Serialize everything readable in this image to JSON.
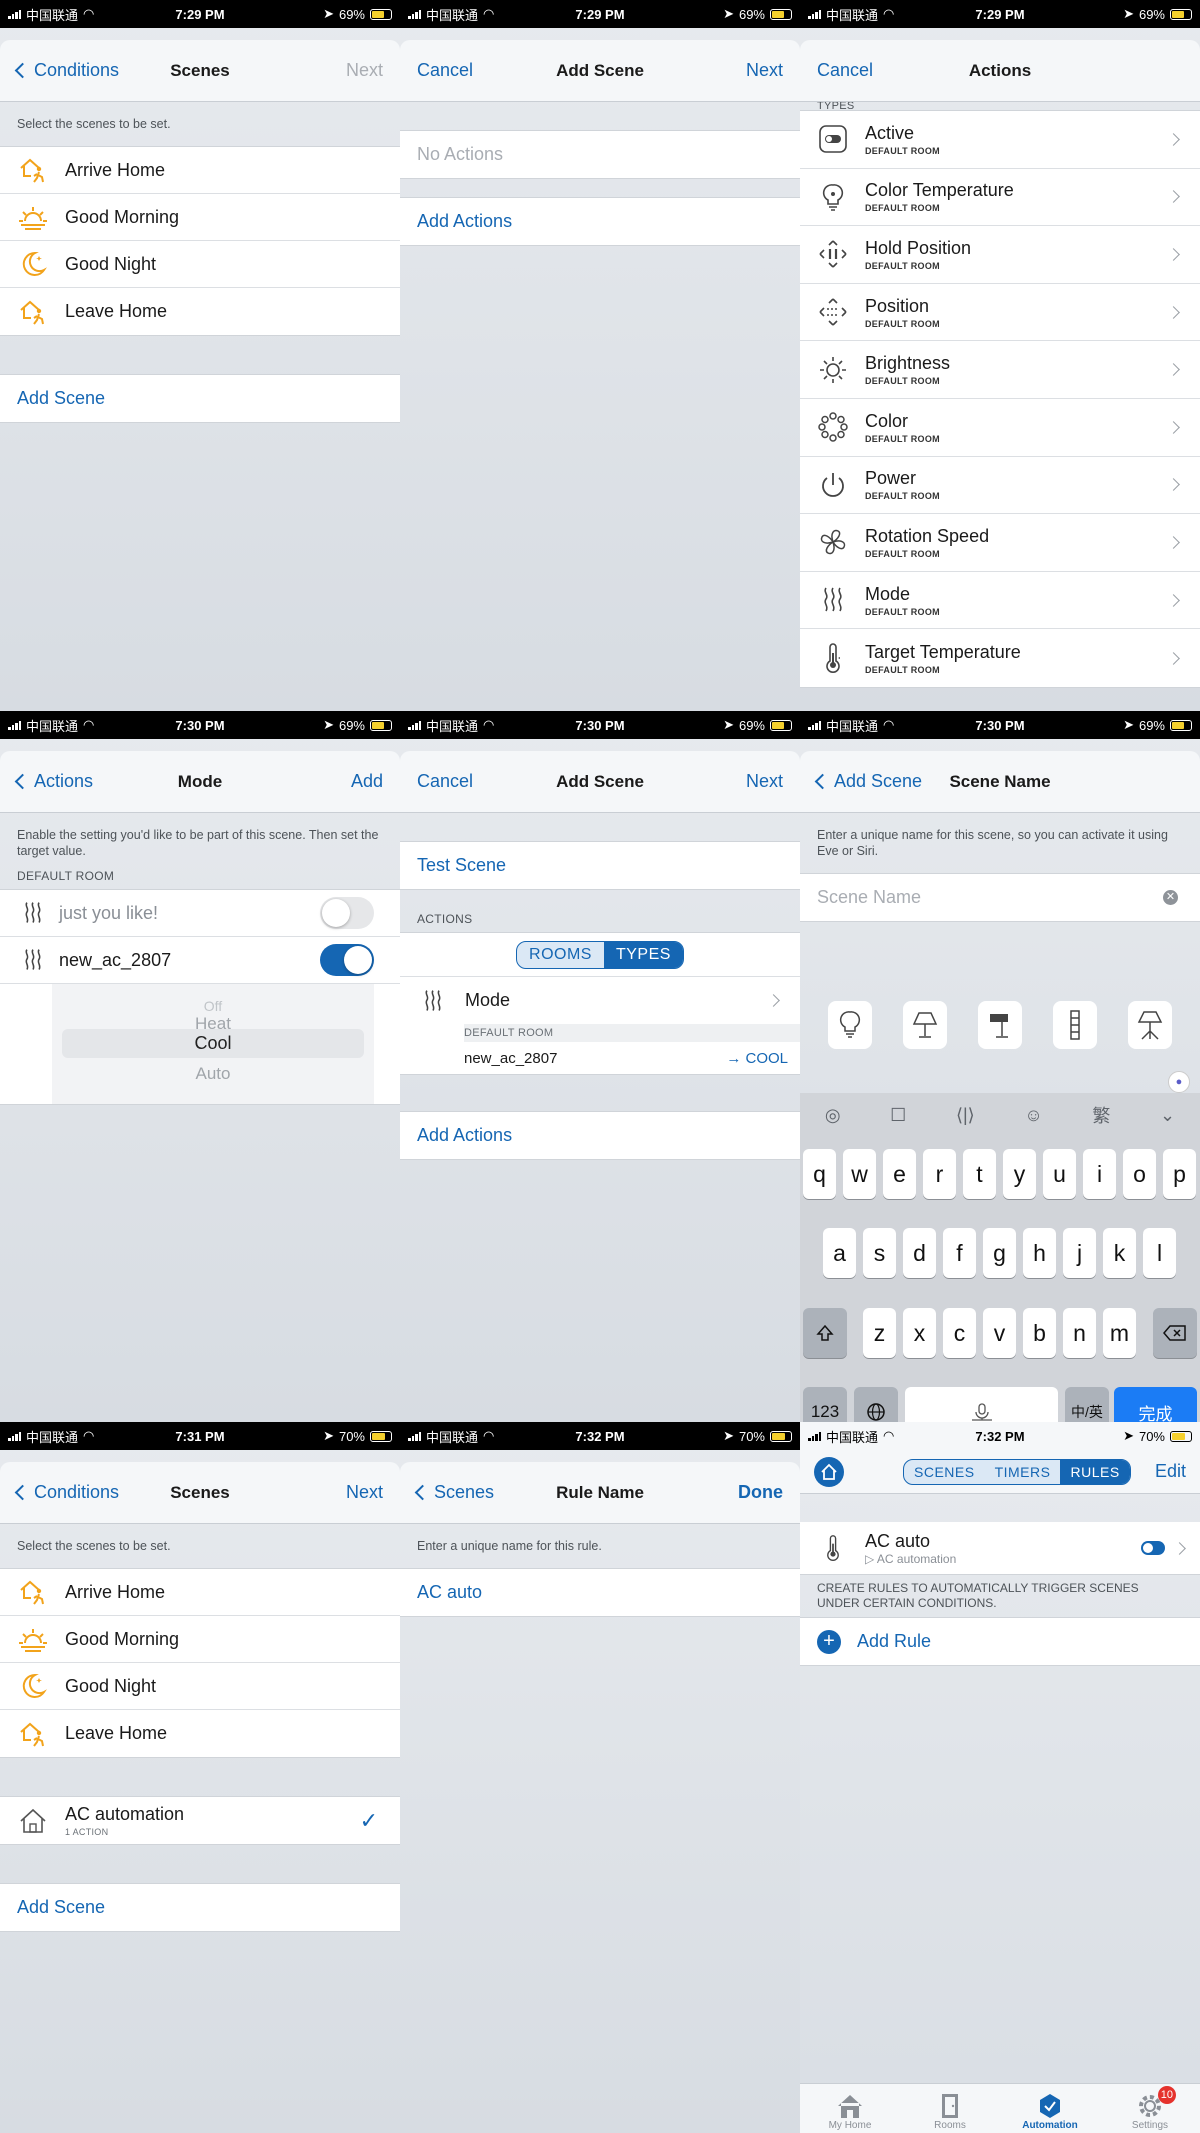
{
  "carrier": "中国联通",
  "p1": {
    "status": {
      "time": "7:29 PM",
      "battery": "69%"
    },
    "nav": {
      "back": "Conditions",
      "title": "Scenes",
      "right": "Next"
    },
    "hint": "Select the scenes to be set.",
    "scenes": [
      "Arrive Home",
      "Good Morning",
      "Good Night",
      "Leave Home"
    ],
    "add_scene": "Add Scene"
  },
  "p2": {
    "status": {
      "time": "7:29 PM",
      "battery": "69%"
    },
    "nav": {
      "left": "Cancel",
      "title": "Add Scene",
      "right": "Next"
    },
    "no_actions": "No Actions",
    "add_actions": "Add Actions"
  },
  "p3": {
    "status": {
      "time": "7:29 PM",
      "battery": "69%"
    },
    "nav": {
      "left": "Cancel",
      "title": "Actions"
    },
    "section": "TYPES",
    "items": [
      {
        "label": "Active",
        "sub": "DEFAULT ROOM",
        "icon": "toggle-icon"
      },
      {
        "label": "Color Temperature",
        "sub": "DEFAULT ROOM",
        "icon": "bulb-icon"
      },
      {
        "label": "Hold Position",
        "sub": "DEFAULT ROOM",
        "icon": "hold-position-icon"
      },
      {
        "label": "Position",
        "sub": "DEFAULT ROOM",
        "icon": "position-icon"
      },
      {
        "label": "Brightness",
        "sub": "DEFAULT ROOM",
        "icon": "sun-icon"
      },
      {
        "label": "Color",
        "sub": "DEFAULT ROOM",
        "icon": "color-wheel-icon"
      },
      {
        "label": "Power",
        "sub": "DEFAULT ROOM",
        "icon": "power-icon"
      },
      {
        "label": "Rotation Speed",
        "sub": "DEFAULT ROOM",
        "icon": "fan-icon"
      },
      {
        "label": "Mode",
        "sub": "DEFAULT ROOM",
        "icon": "heat-waves-icon"
      },
      {
        "label": "Target Temperature",
        "sub": "DEFAULT ROOM",
        "icon": "thermometer-icon"
      }
    ]
  },
  "p4": {
    "status": {
      "time": "7:30 PM",
      "battery": "69%"
    },
    "nav": {
      "back": "Actions",
      "title": "Mode",
      "right": "Add"
    },
    "hint": "Enable the setting you'd like to be part of this scene. Then set the target value.",
    "section": "DEFAULT ROOM",
    "rows": [
      {
        "label": "just you like!",
        "enabled": false
      },
      {
        "label": "new_ac_2807",
        "enabled": true
      }
    ],
    "picker": [
      "Off",
      "Heat",
      "Cool",
      "Auto"
    ]
  },
  "p5": {
    "status": {
      "time": "7:30 PM",
      "battery": "69%"
    },
    "nav": {
      "left": "Cancel",
      "title": "Add Scene",
      "right": "Next"
    },
    "scene_name": "Test Scene",
    "section": "ACTIONS",
    "seg": [
      "ROOMS",
      "TYPES"
    ],
    "action": "Mode",
    "room": "DEFAULT ROOM",
    "device": "new_ac_2807",
    "value": "→ COOL",
    "add_actions": "Add Actions"
  },
  "p6": {
    "status": {
      "time": "7:30 PM",
      "battery": "69%"
    },
    "nav": {
      "back": "Add Scene",
      "title": "Scene Name"
    },
    "hint": "Enter a unique name for this scene, so you can activate it using Eve or Siri.",
    "placeholder": "Scene Name",
    "kb_row1": [
      "q",
      "w",
      "e",
      "r",
      "t",
      "y",
      "u",
      "i",
      "o",
      "p"
    ],
    "kb_row2": [
      "a",
      "s",
      "d",
      "f",
      "g",
      "h",
      "j",
      "k",
      "l"
    ],
    "kb_row3": [
      "z",
      "x",
      "c",
      "v",
      "b",
      "n",
      "m"
    ],
    "kb_trad": "繁",
    "kb_123": "123",
    "kb_lang": "中/英",
    "kb_done": "完成"
  },
  "p7": {
    "status": {
      "time": "7:31 PM",
      "battery": "70%"
    },
    "nav": {
      "back": "Conditions",
      "title": "Scenes",
      "right": "Next"
    },
    "hint": "Select the scenes to be set.",
    "scenes": [
      "Arrive Home",
      "Good Morning",
      "Good Night",
      "Leave Home"
    ],
    "custom": {
      "label": "AC automation",
      "sub": "1 ACTION"
    },
    "add_scene": "Add Scene"
  },
  "p8": {
    "status": {
      "time": "7:32 PM",
      "battery": "70%"
    },
    "nav": {
      "back": "Scenes",
      "title": "Rule Name",
      "right": "Done"
    },
    "hint": "Enter a unique name for this rule.",
    "value": "AC auto"
  },
  "p9": {
    "status": {
      "time": "7:32 PM",
      "battery": "70%"
    },
    "seg": [
      "SCENES",
      "TIMERS",
      "RULES"
    ],
    "edit": "Edit",
    "rule": {
      "label": "AC auto",
      "sub": "▷ AC automation"
    },
    "info": "CREATE RULES TO AUTOMATICALLY TRIGGER SCENES UNDER CERTAIN CONDITIONS.",
    "add_rule": "Add Rule",
    "tabs": [
      "My Home",
      "Rooms",
      "Automation",
      "Settings"
    ],
    "badge": "10"
  },
  "colors": {
    "accent": "#1566b3",
    "scene_icon": "#f2a31b"
  }
}
